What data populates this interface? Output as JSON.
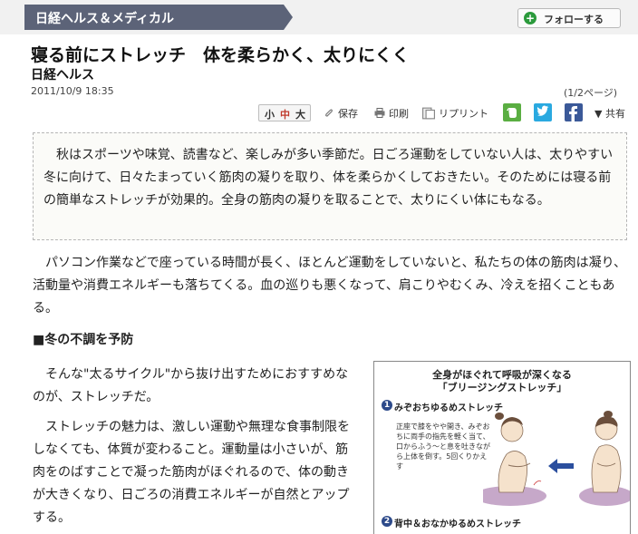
{
  "header": {
    "channel": "日経ヘルス＆メディカル",
    "follow_label": "フォローする",
    "follow_icon": "plus-circle-icon"
  },
  "article": {
    "title": "寝る前にストレッチ　体を柔らかく、太りにくく",
    "source": "日経ヘルス",
    "date": "2011/10/9 18:35",
    "page_indicator": "(1/2ページ)"
  },
  "toolbar": {
    "font_small": "小",
    "font_medium": "中",
    "font_large": "大",
    "save": "保存",
    "print": "印刷",
    "reprint": "リプリント",
    "share": "▼ 共有",
    "evernote_icon": "evernote-icon",
    "twitter_icon": "twitter-icon",
    "facebook_icon": "facebook-icon",
    "colors": {
      "twitter": "#2aa9e0",
      "facebook": "#3b5998",
      "evernote": "#5aae42",
      "font_active": "#c0392b"
    }
  },
  "body": {
    "summary": "秋はスポーツや味覚、読書など、楽しみが多い季節だ。日ごろ運動をしていない人は、太りやすい冬に向けて、日々たまっていく筋肉の凝りを取り、体を柔らかくしておきたい。そのためには寝る前の簡単なストレッチが効果的。全身の筋肉の凝りを取ることで、太りにくい体にもなる。",
    "paragraph1": "パソコン作業などで座っている時間が長く、ほとんど運動をしていないと、私たちの体の筋肉は凝り、活動量や消費エネルギーも落ちてくる。血の巡りも悪くなって、肩こりやむくみ、冷えを招くこともある。",
    "section_heading": "■冬の不調を予防",
    "paragraph2": "そんな\"太るサイクル\"から抜け出すためにおすすめなのが、ストレッチだ。",
    "paragraph3": "ストレッチの魅力は、激しい運動や無理な食事制限をしなくても、体質が変わること。運動量は小さいが、筋肉をのばすことで凝った筋肉がほぐれるので、体の動きが大きくなり、日ごろの消費エネルギーが自然とアップする。"
  },
  "figure": {
    "title_line1": "全身がほぐれて呼吸が深くなる",
    "title_line2": "「ブリージングストレッチ」",
    "step1_num": "1",
    "step1_label": "みぞおちゆるめストレッチ",
    "step1_desc": "正座で膝をやや開き、みぞおちに両手の指先を軽く当て、口からふう〜と息を吐きながら上体を倒す。5回くりかえす",
    "step2_num": "2",
    "step2_label": "背中＆おなかゆるめストレッチ",
    "colors": {
      "step_badge": "#2d4a8a",
      "arrow": "#2b4f9e",
      "skirt": "#c6a8c9",
      "skin": "#f5e2cc"
    }
  }
}
